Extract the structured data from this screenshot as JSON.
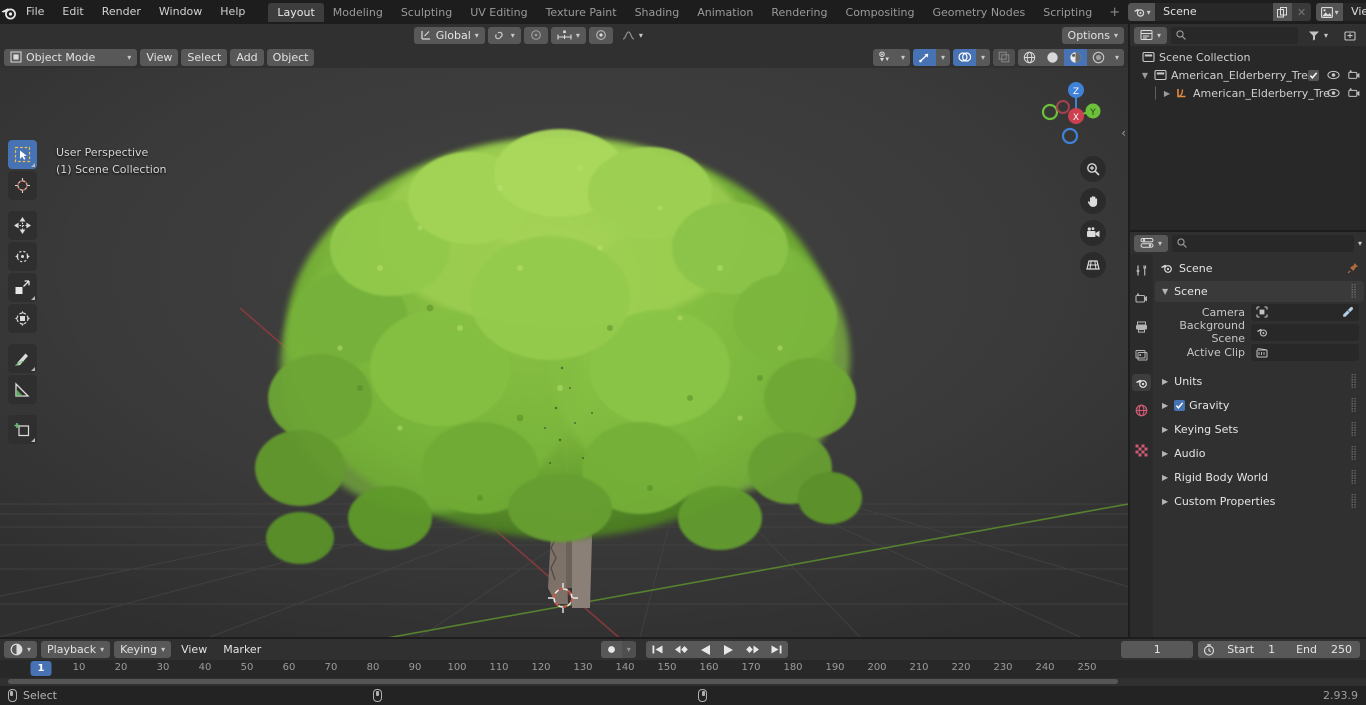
{
  "topbar": {
    "logo_icon": "blender-logo-icon",
    "menus": [
      "File",
      "Edit",
      "Render",
      "Window",
      "Help"
    ],
    "workspaces": [
      {
        "label": "Layout",
        "active": true
      },
      {
        "label": "Modeling",
        "active": false
      },
      {
        "label": "Sculpting",
        "active": false
      },
      {
        "label": "UV Editing",
        "active": false
      },
      {
        "label": "Texture Paint",
        "active": false
      },
      {
        "label": "Shading",
        "active": false
      },
      {
        "label": "Animation",
        "active": false
      },
      {
        "label": "Rendering",
        "active": false
      },
      {
        "label": "Compositing",
        "active": false
      },
      {
        "label": "Geometry Nodes",
        "active": false
      },
      {
        "label": "Scripting",
        "active": false
      }
    ],
    "add_workspace": "+",
    "scene": {
      "name": "Scene",
      "icon": "scene-icon",
      "copy_icon": "duplicate-icon",
      "unlink_icon": "unlink-x-icon"
    },
    "view_layer": {
      "name": "View Layer",
      "icon": "view-layer-icon",
      "copy_icon": "duplicate-icon",
      "unlink_icon": "unlink-x-icon"
    }
  },
  "viewport": {
    "mode": "Object Mode",
    "menus": [
      "View",
      "Select",
      "Add",
      "Object"
    ],
    "transform_orientation": "Global",
    "options_label": "Options",
    "overlay_text_line1": "User Perspective",
    "overlay_text_line2": "(1) Scene Collection",
    "tools": [
      {
        "name": "tweak-select-box-tool",
        "active": true
      },
      {
        "name": "cursor-tool",
        "active": false
      },
      {
        "name": "move-tool",
        "active": false
      },
      {
        "name": "rotate-tool",
        "active": false
      },
      {
        "name": "scale-tool",
        "active": false
      },
      {
        "name": "transform-tool",
        "active": false
      },
      {
        "name": "annotate-tool",
        "active": false
      },
      {
        "name": "measure-tool",
        "active": false
      },
      {
        "name": "add-cube-tool",
        "active": false
      }
    ],
    "gizmo_axes": [
      {
        "label": "Z",
        "color": "#3f82d8"
      },
      {
        "label": "X",
        "color": "#cd4050"
      },
      {
        "label": "Y",
        "color": "#6cc03a"
      }
    ],
    "nav_buttons": [
      "zoom-icon",
      "pan-hand-icon",
      "camera-icon",
      "ortho-grid-icon"
    ],
    "shading_modes": [
      {
        "name": "wireframe-shading",
        "active": false
      },
      {
        "name": "solid-shading",
        "active": false
      },
      {
        "name": "material-preview-shading",
        "active": true
      },
      {
        "name": "rendered-shading",
        "active": false
      }
    ]
  },
  "outliner": {
    "display_mode_icon": "outliner-editor-icon",
    "filter_icon": "filter-icon",
    "search_placeholder": "",
    "rows": [
      {
        "label": "Scene Collection",
        "icon": "collection-icon",
        "indent": 0,
        "has_disclosure": false,
        "checkbox": false,
        "eye": false,
        "camera": false
      },
      {
        "label": "American_Elderberry_Tree",
        "icon": "collection-icon",
        "indent": 1,
        "has_disclosure": true,
        "checkbox": true,
        "eye": true,
        "camera": true
      },
      {
        "label": "American_Elderberry_Tre",
        "icon": "curve-object-icon",
        "indent": 2,
        "has_disclosure": true,
        "checkbox": false,
        "eye": true,
        "camera": true
      }
    ]
  },
  "properties": {
    "editor_icon": "properties-editor-icon",
    "search_placeholder": "",
    "tabs": [
      {
        "name": "tool-tab",
        "active": false
      },
      {
        "name": "render-tab",
        "active": false
      },
      {
        "name": "output-tab",
        "active": false
      },
      {
        "name": "view-layer-tab",
        "active": false
      },
      {
        "name": "scene-tab",
        "active": true
      },
      {
        "name": "world-tab",
        "active": false
      },
      {
        "name": "texture-tab",
        "active": false
      }
    ],
    "breadcrumb": "Scene",
    "breadcrumb_icon": "scene-icon",
    "pin_icon": "pin-icon",
    "panel_title": "Scene",
    "fields": [
      {
        "label": "Camera",
        "value": "",
        "icon": "camera-object-icon",
        "eyedropper": true
      },
      {
        "label": "Background Scene",
        "value": "",
        "icon": "scene-icon",
        "eyedropper": false
      },
      {
        "label": "Active Clip",
        "value": "",
        "icon": "movie-clip-icon",
        "eyedropper": false
      }
    ],
    "sections": [
      {
        "label": "Units",
        "checkbox": false
      },
      {
        "label": "Gravity",
        "checkbox": true
      },
      {
        "label": "Keying Sets",
        "checkbox": false
      },
      {
        "label": "Audio",
        "checkbox": false
      },
      {
        "label": "Rigid Body World",
        "checkbox": false
      },
      {
        "label": "Custom Properties",
        "checkbox": false
      }
    ]
  },
  "timeline": {
    "editor_icon": "timeline-editor-icon",
    "menus": [
      "Playback",
      "Keying",
      "View",
      "Marker"
    ],
    "record_icon": "record-icon",
    "transport": [
      "jump-to-start-icon",
      "prev-keyframe-icon",
      "play-reverse-icon",
      "play-icon",
      "next-keyframe-icon",
      "jump-to-end-icon"
    ],
    "current_frame": "1",
    "auto_key_icon": "auto-keying-icon",
    "start_label": "Start",
    "start_value": "1",
    "end_label": "End",
    "end_value": "250",
    "ruler_ticks": [
      "10",
      "20",
      "30",
      "40",
      "50",
      "60",
      "70",
      "80",
      "90",
      "100",
      "110",
      "120",
      "130",
      "140",
      "150",
      "160",
      "170",
      "180",
      "190",
      "200",
      "210",
      "220",
      "230",
      "240",
      "250"
    ],
    "playhead_frame": "1"
  },
  "status": {
    "left_mouse_icon": "left-mouse-icon",
    "select_label": "Select",
    "middle_mouse_icon": "middle-mouse-icon",
    "right_mouse_icon": "right-mouse-icon",
    "version": "2.93.9"
  }
}
